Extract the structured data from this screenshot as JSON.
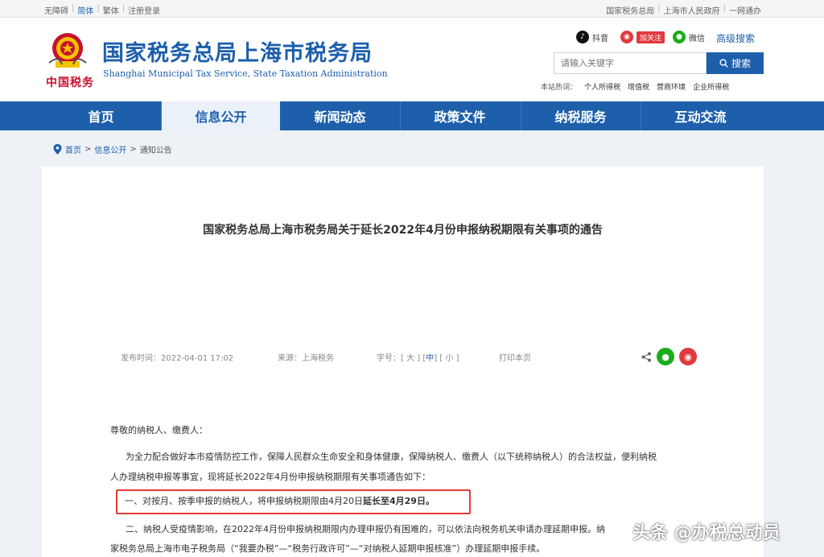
{
  "topbar": {
    "left": [
      "无障碍",
      "简体",
      "繁体",
      "注册登录"
    ],
    "right": [
      "国家税务总局",
      "上海市人民政府",
      "一网通办"
    ]
  },
  "header": {
    "seal_text": "中国税务",
    "title": "国家税务总局上海市税务局",
    "subtitle": "Shanghai Municipal Tax Service, State Taxation Administration",
    "douyin": "抖音",
    "weibo_follow": "加关注",
    "wechat": "微信",
    "advanced_search": "高级搜索",
    "search_placeholder": "请输入关键字",
    "search_button": "搜索",
    "hot_label": "本站热词：",
    "hot_words": [
      "个人所得税",
      "增值税",
      "营商环境",
      "企业所得税"
    ]
  },
  "nav": {
    "items": [
      "首页",
      "信息公开",
      "新闻动态",
      "政策文件",
      "纳税服务",
      "互动交流"
    ]
  },
  "breadcrumb": [
    "首页",
    "信息公开",
    "通知公告"
  ],
  "article": {
    "title": "国家税务总局上海市税务局关于延长2022年4月份申报纳税期限有关事项的通告",
    "publish_time": "发布时间：2022-04-01 17:02",
    "source": "来源：上海税务",
    "font_size_label": "字号：",
    "font_big": "大",
    "font_mid": "中",
    "font_small": "小",
    "print": "打印本页",
    "greeting": "尊敬的纳税人、缴费人：",
    "para1_line1": "为全力配合做好本市疫情防控工作，保障人民群众生命安全和身体健康，保障纳税人、缴费人（以下统称纳税人）的合法权益，便利纳税",
    "para1_line2": "人办理纳税申报等事宜，现将延长2022年4月份申报纳税期限有关事项通告如下：",
    "item1_normal": "一、对按月、按季申报的纳税人，将申报纳税期限由4月20日",
    "item1_bold": "延长至4月29日。",
    "item2_line1": "二、纳税人受疫情影响，在2022年4月份申报纳税期限内办理申报仍有困难的，可以依法向税务机关申请办理延期申报。纳",
    "item2_line2": "家税务总局上海市电子税务局（“我要办税”—“税务行政许可”—“对纳税人延期申报核准”）办理延期申报手续。"
  },
  "watermark": "头条 @办税总动员"
}
